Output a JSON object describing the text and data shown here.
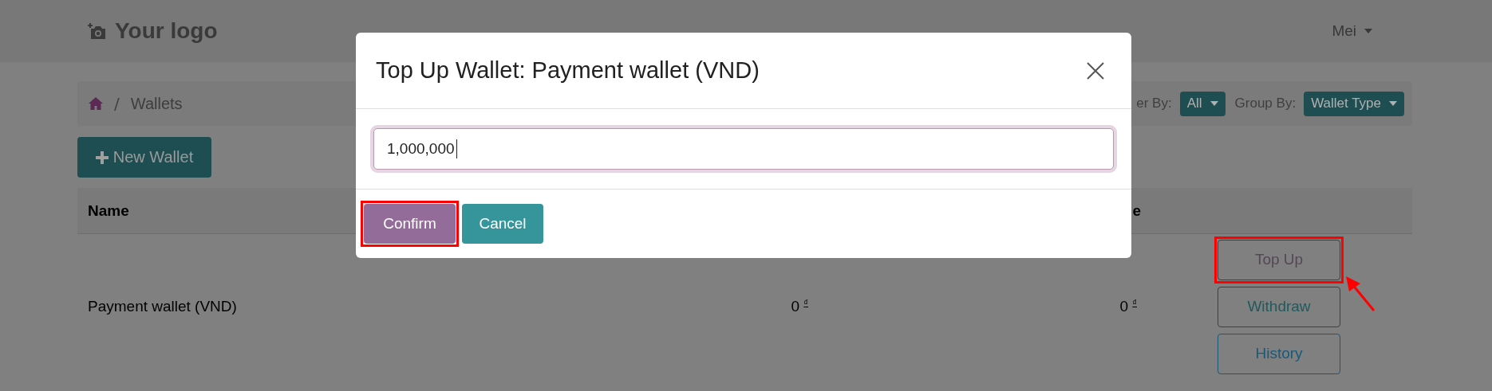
{
  "header": {
    "logo": "Your logo",
    "user": "Mei"
  },
  "breadcrumb": {
    "items": [
      {
        "separator": "/",
        "label": "Wallets"
      }
    ]
  },
  "filters": [
    {
      "label": "er By:",
      "value": "All"
    },
    {
      "label": "Group By:",
      "value": "Wallet Type"
    }
  ],
  "new_button": "New Wallet",
  "table": {
    "name_column": "Name",
    "column_3": "e",
    "rows": [
      {
        "name": "Payment wallet (VND)",
        "column_2": "0 $^{₫}$",
        "column_3": "0 $^{₫}$",
        "actions": [
          {
            "label": "Top Up",
            "kind": "topup",
            "highlighted": true,
            "arrow": true
          },
          {
            "label": "Withdraw",
            "kind": "withdraw",
            "highlighted": false,
            "arrow": false
          },
          {
            "label": "History",
            "kind": "history",
            "highlighted": false,
            "arrow": false
          }
        ]
      }
    ]
  },
  "modal": {
    "title": "Top Up Wallet: Payment wallet (VND)",
    "amount": "1,000,000",
    "focused": true,
    "buttons": [
      {
        "label": "Confirm",
        "kind": "primary",
        "highlighted": true
      },
      {
        "label": "Cancel",
        "kind": "secondary",
        "highlighted": false
      }
    ]
  }
}
